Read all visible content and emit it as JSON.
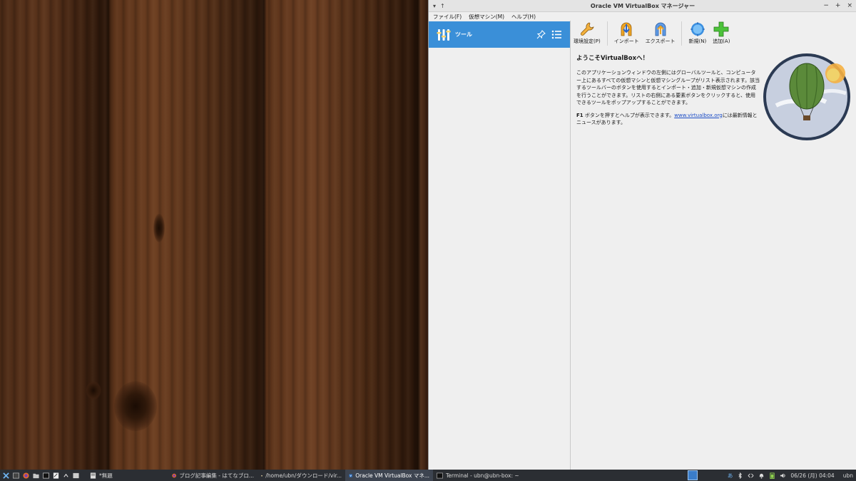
{
  "window": {
    "title": "Oracle VM VirtualBox マネージャー",
    "title_left_symbols": [
      "▾",
      "↑"
    ],
    "controls": [
      "−",
      "+",
      "×"
    ]
  },
  "menu": [
    "ファイル(F)",
    "仮想マシン(M)",
    "ヘルプ(H)"
  ],
  "sidebar": {
    "tools_label": "ツール"
  },
  "toolbar": {
    "preferences": "環境設定(P)",
    "import": "インポート",
    "export": "エクスポート",
    "new": "新規(N)",
    "add": "追加(A)"
  },
  "welcome": {
    "heading": "ようこそVirtualBoxへ！",
    "paragraph1": "このアプリケーションウィンドウの左側にはグローバルツールと、コンピューター上にあるすべての仮想マシンと仮想マシングループがリスト表示されます。該当するツールバーのボタンを使用するとインポート・追加・新規仮想マシンの作成を行うことができます。リストの右側にある要素ボタンをクリックすると、使用できるツールをポップアップすることができます。",
    "f1_key": "F1",
    "paragraph2_a": " ボタンを押すとヘルプが表示できます。",
    "link": "www.virtualbox.org",
    "paragraph2_b": "には最新情報とニュースがあります。"
  },
  "taskbar": {
    "tasks": [
      {
        "label": "*無題",
        "icon": "text-editor-icon"
      },
      {
        "label": "ブログ記事編集 - はてなブロ...",
        "icon": "firefox-icon"
      },
      {
        "label": "/home/ubn/ダウンロード/vir...",
        "icon": "folder-icon"
      },
      {
        "label": "Oracle VM VirtualBox マネ...",
        "icon": "virtualbox-icon",
        "active": true
      },
      {
        "label": "Terminal - ubn@ubn-box: ~",
        "icon": "terminal-icon"
      }
    ],
    "clock": "06/26 (月) 04:04",
    "user": "ubn",
    "tray_input": "あ"
  },
  "colors": {
    "selection": "#3a8fd8",
    "window_bg": "#efefef",
    "taskbar_bg": "#2b2e33",
    "link": "#1a4cc6"
  }
}
